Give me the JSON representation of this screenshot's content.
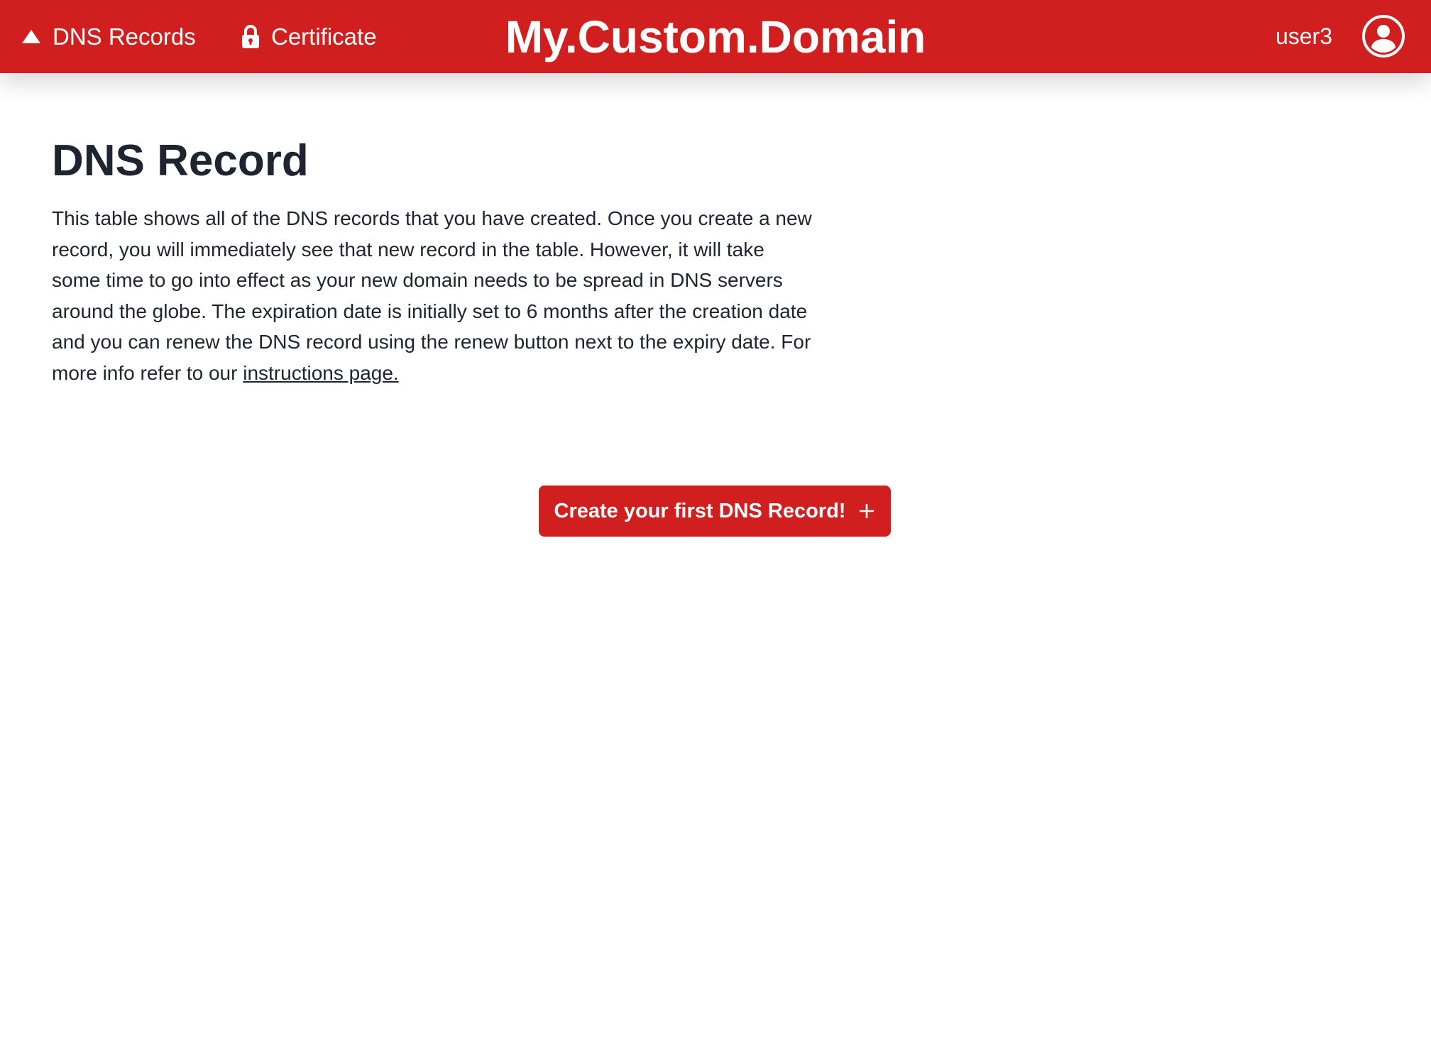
{
  "header": {
    "nav": [
      {
        "label": "DNS Records",
        "icon": "triangle-up-icon"
      },
      {
        "label": "Certificate",
        "icon": "lock-icon"
      }
    ],
    "brand": "My.Custom.Domain",
    "username": "user3",
    "avatar_icon": "user-circle-icon"
  },
  "main": {
    "title": "DNS Record",
    "description": "This table shows all of the DNS records that you have created. Once you create a new record, you will immediately see that new record in the table. However, it will take some time to go into effect as your new domain needs to be spread in DNS servers around the globe. The expiration date is initially set to 6 months after the creation date and you can renew the DNS record using the renew button next to the expiry date. For more info refer to our ",
    "link_text": "instructions page.",
    "create_button_label": "Create your first DNS Record!"
  },
  "colors": {
    "accent": "#d11f1f",
    "text": "#1f2530",
    "background": "#ffffff"
  }
}
